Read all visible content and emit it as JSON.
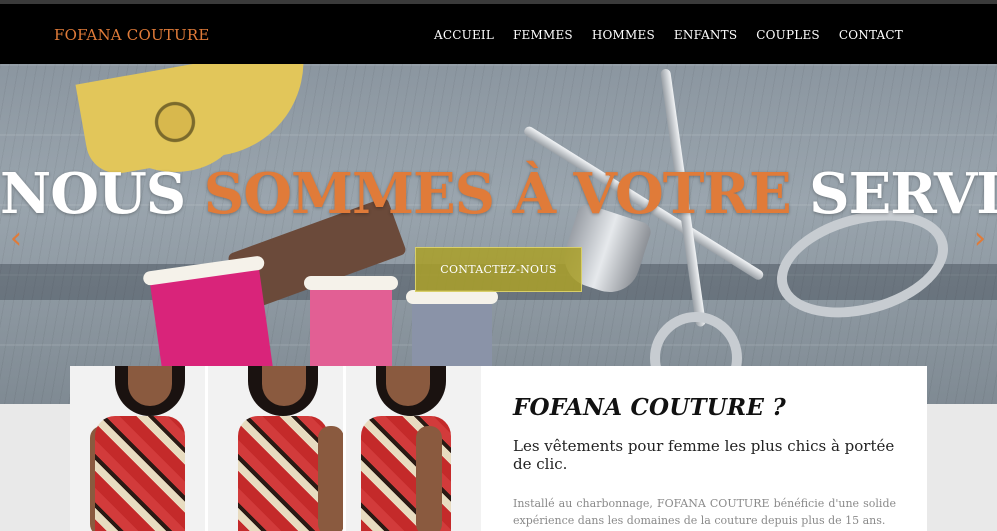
{
  "nav": {
    "brand": "FOFANA COUTURE",
    "items": [
      {
        "label": "ACCUEIL"
      },
      {
        "label": "FEMMES"
      },
      {
        "label": "HOMMES"
      },
      {
        "label": "ENFANTS"
      },
      {
        "label": "COUPLES"
      },
      {
        "label": "CONTACT"
      }
    ]
  },
  "hero": {
    "title_part1": "NOUS ",
    "title_part2": "SOMMES À VOTRE",
    "title_part3": " SERVICE",
    "button_label": "CONTACTEZ-NOUS",
    "prev_icon": "‹",
    "next_icon": "›"
  },
  "about": {
    "heading": "FOFANA COUTURE ?",
    "tagline": "Les vêtements pour femme les plus chics à portée de clic.",
    "paragraph": "Installé au charbonnage, FOFANA COUTURE bénéficie d'une solide expérience dans les domaines de la couture depuis plus de 15 ans."
  },
  "colors": {
    "accent": "#e07b39",
    "nav_bg": "#000000",
    "button_bg": "#aaa028"
  }
}
